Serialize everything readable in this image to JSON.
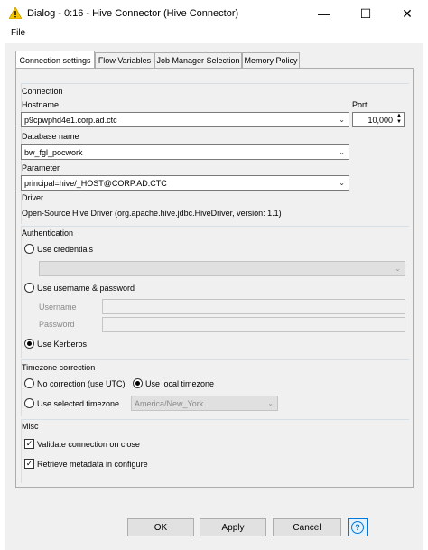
{
  "window": {
    "title": "Dialog - 0:16 - Hive Connector (Hive Connector)",
    "minimize": "—",
    "maximize": "☐",
    "close": "✕"
  },
  "menu": {
    "file": "File"
  },
  "tabs": [
    {
      "label": "Connection settings",
      "active": true
    },
    {
      "label": "Flow Variables",
      "active": false
    },
    {
      "label": "Job Manager Selection",
      "active": false
    },
    {
      "label": "Memory Policy",
      "active": false
    }
  ],
  "connection": {
    "section": "Connection",
    "hostname_label": "Hostname",
    "hostname_value": "p9cpwphd4e1.corp.ad.ctc",
    "port_label": "Port",
    "port_value": "10,000",
    "database_label": "Database name",
    "database_value": "bw_fgl_pocwork",
    "parameter_label": "Parameter",
    "parameter_value": "principal=hive/_HOST@CORP.AD.CTC",
    "driver_label": "Driver",
    "driver_value": "Open-Source Hive Driver (org.apache.hive.jdbc.HiveDriver, version: 1.1)"
  },
  "authentication": {
    "section": "Authentication",
    "use_credentials": "Use credentials",
    "use_username_password": "Use username & password",
    "username_label": "Username",
    "password_label": "Password",
    "use_kerberos": "Use Kerberos",
    "selected": "kerberos"
  },
  "timezone": {
    "section": "Timezone correction",
    "no_correction": "No correction (use UTC)",
    "use_local": "Use local timezone",
    "use_selected": "Use selected timezone",
    "selected_zone": "America/New_York",
    "selected": "local"
  },
  "misc": {
    "section": "Misc",
    "validate": "Validate connection on close",
    "validate_checked": true,
    "retrieve": "Retrieve metadata in configure",
    "retrieve_checked": true
  },
  "buttons": {
    "ok": "OK",
    "apply": "Apply",
    "cancel": "Cancel",
    "help": "?"
  },
  "colors": {
    "accent": "#0078d7",
    "warning": "#f5c400"
  }
}
